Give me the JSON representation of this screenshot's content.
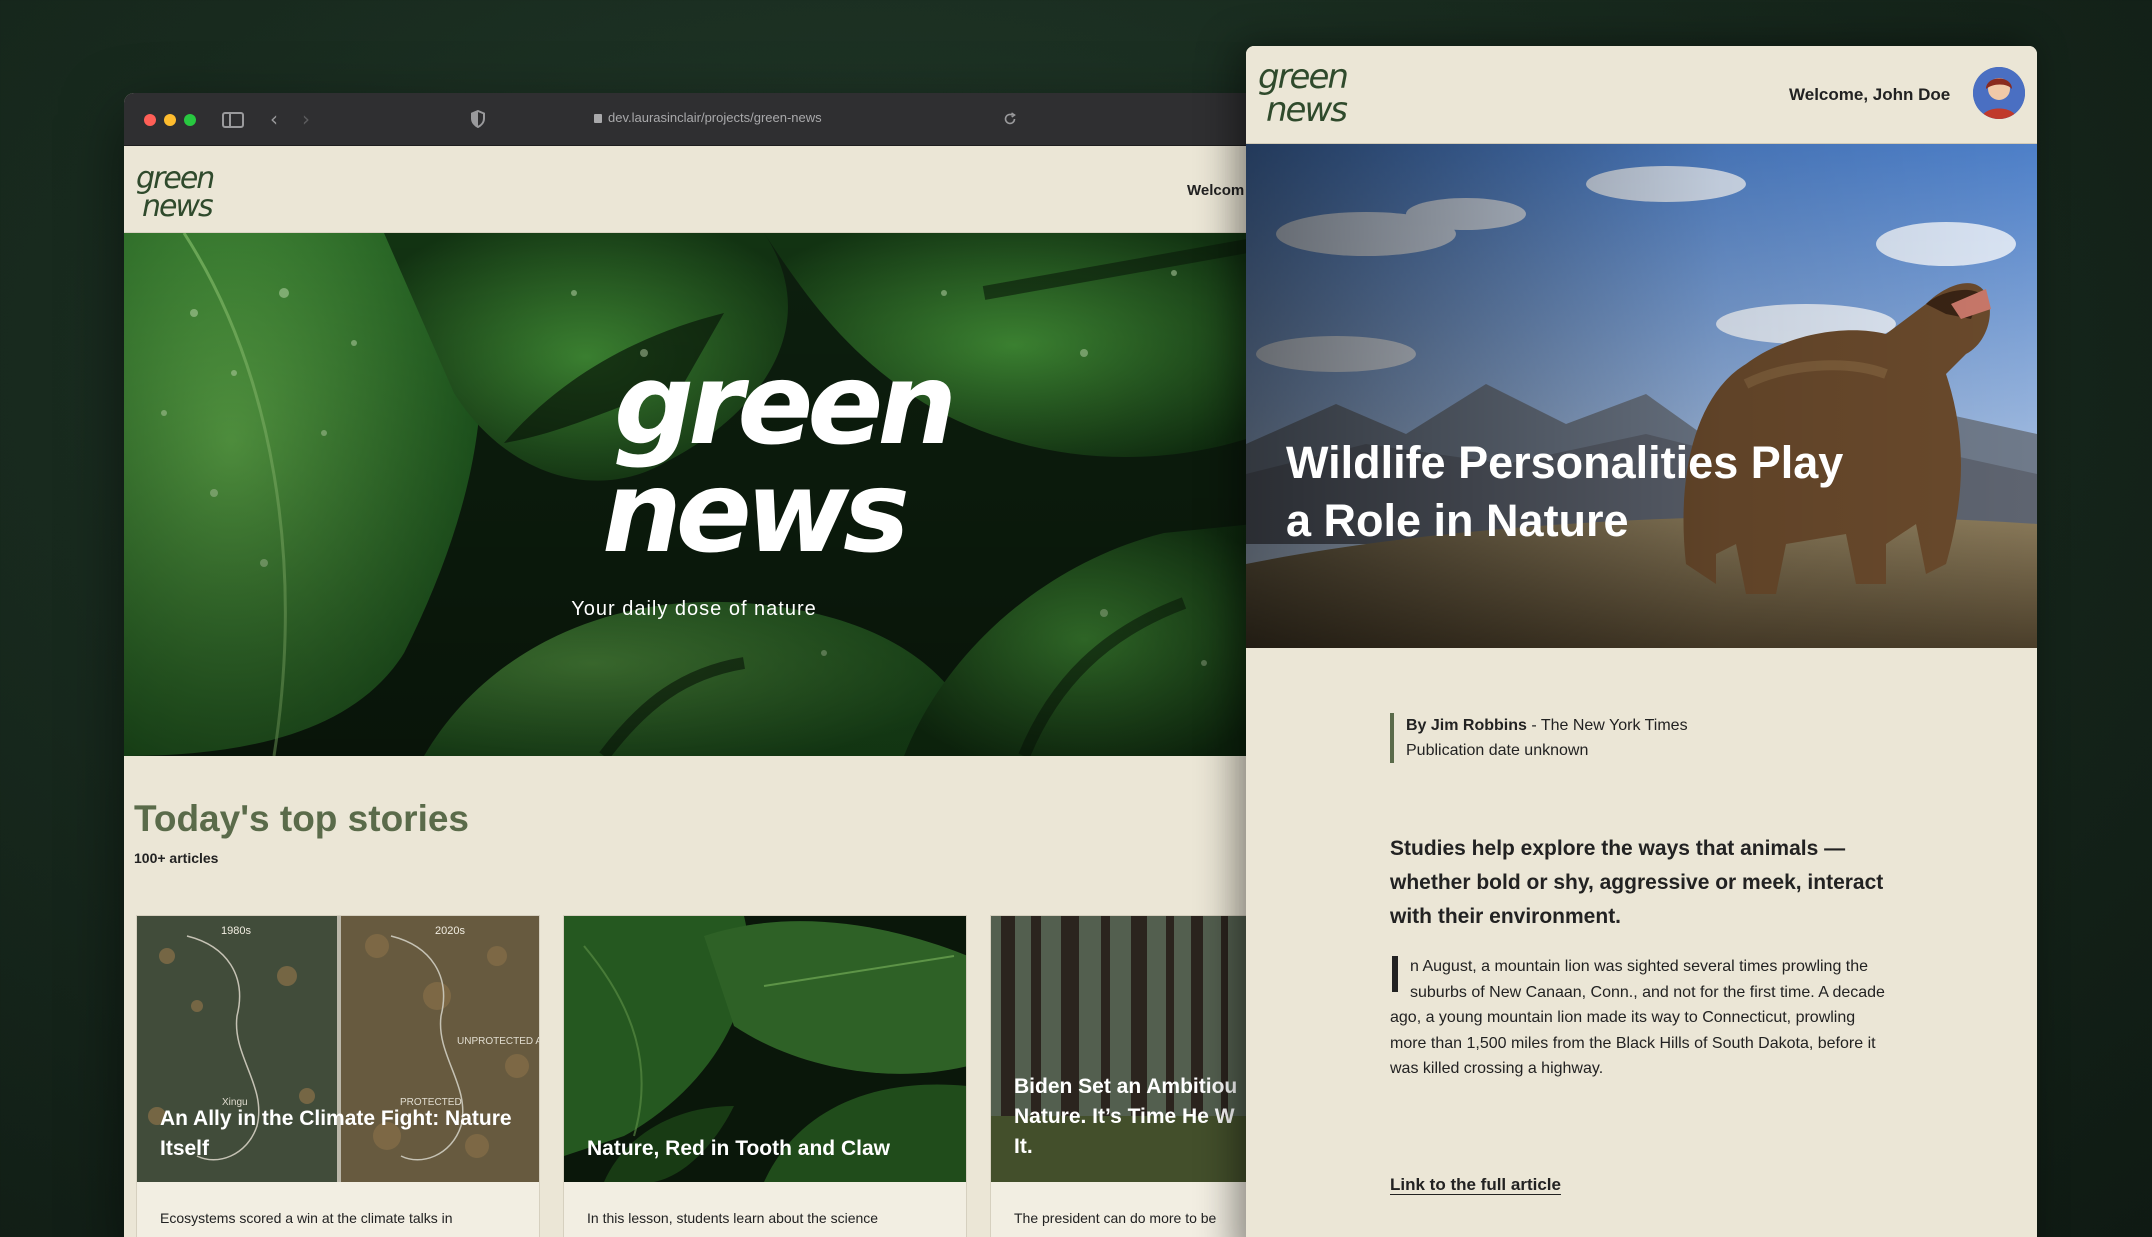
{
  "browser": {
    "url": "dev.laurasinclair/projects/green-news",
    "back_icon": "chevron-left-icon",
    "forward_icon": "chevron-right-icon",
    "reload_icon": "reload-icon",
    "shield_icon": "shield-icon"
  },
  "site": {
    "logo_text": "green news",
    "welcome_partial": "Welcom",
    "tagline": "Your daily dose of nature"
  },
  "stories": {
    "heading": "Today's top stories",
    "count": "100+ articles",
    "cards": [
      {
        "title": "An Ally in the Climate Fight: Nature Itself",
        "excerpt": "Ecosystems scored a win at the climate talks in",
        "map_labels": [
          "1980s",
          "2020s",
          "UNPROTECTED AREA",
          "PROTECTED",
          "Xingu"
        ]
      },
      {
        "title": "Nature, Red in Tooth and Claw",
        "excerpt": "In this lesson, students learn about the science"
      },
      {
        "title": "Biden Set an Ambitiou Nature. It’s Time He W It.",
        "excerpt": "The president can do more to be"
      }
    ]
  },
  "article_panel": {
    "welcome": "Welcome, John Doe",
    "title": "Wildlife Personalities Play a Role in Nature",
    "author_prefix": "By Jim Robbins",
    "source": " - The New York Times",
    "date": "Publication date unknown",
    "lede": "Studies help explore the ways that animals — whether bold or shy, aggressive or meek, interact with their environment.",
    "body": "n August, a mountain lion was sighted several times prowling the suburbs of New Canaan, Conn., and not for the first time. A decade ago, a young mountain lion made its way to Connecticut, prowling more than 1,500 miles from the Black Hills of South Dakota, before it was killed crossing a highway.",
    "link": "Link to the full article"
  },
  "colors": {
    "page_bg": "#182a1e",
    "cream": "#ebe6d6",
    "brand_green": "#5a6b4a",
    "logo_green": "#2f4a2c"
  }
}
